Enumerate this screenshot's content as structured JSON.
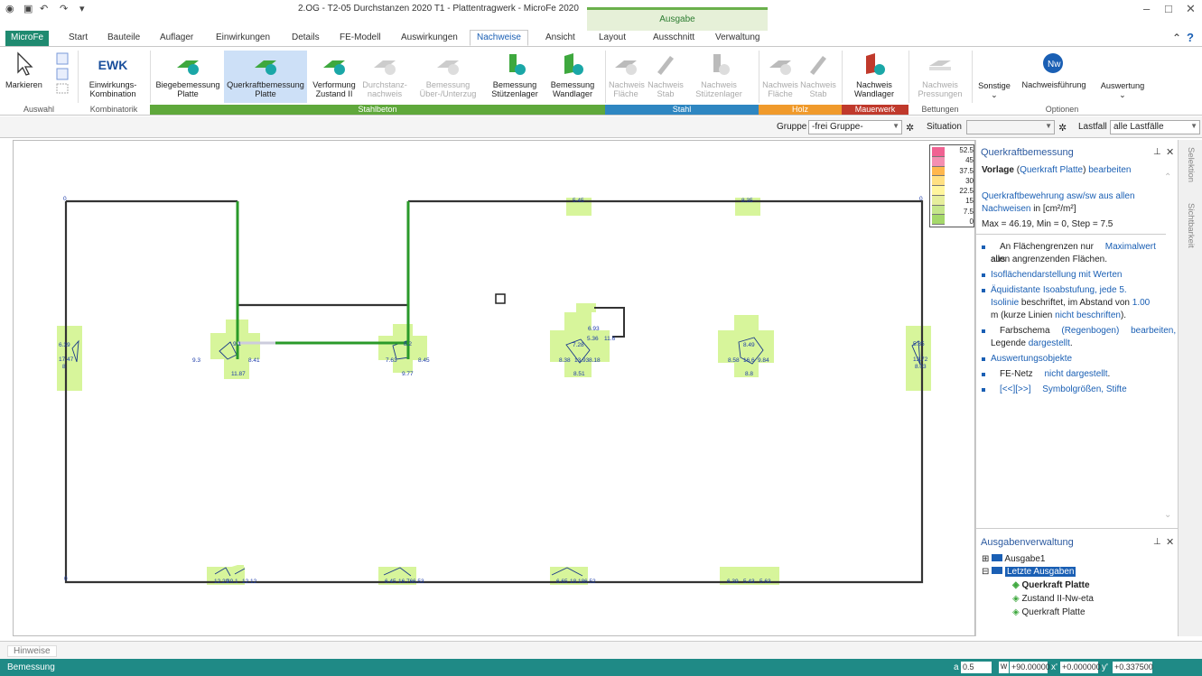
{
  "window": {
    "title": "2.OG - T2-05 Durchstanzen 2020 T1 - Plattentragwerk - MicroFe 2020",
    "context_group": "Ausgabe"
  },
  "tabs": [
    "Start",
    "Bauteile",
    "Auflager",
    "Einwirkungen",
    "Details",
    "FE-Modell",
    "Auswirkungen",
    "Nachweise",
    "Ansicht",
    "Layout",
    "Ausschnitt",
    "Verwaltung"
  ],
  "file_tab": "MicroFe",
  "ribbon": {
    "markieren": "Markieren",
    "ewk": "EWK",
    "ewk_label1": "Einwirkungs-",
    "ewk_label2": "Kombination",
    "biege1": "Biegebemessung",
    "biege2": "Platte",
    "quer1": "Querkraftbemessung",
    "quer2": "Platte",
    "verf1": "Verformung",
    "verf2": "Zustand II",
    "durch1": "Durchstanz-",
    "durch2": "nachweis",
    "bem1": "Bemessung",
    "bem2": "Über-/Unterzug",
    "bems1": "Bemessung",
    "bems2": "Stützenlager",
    "bemw1": "Bemessung",
    "bemw2": "Wandlager",
    "nf1": "Nachweis",
    "nf2": "Fläche",
    "ns1": "Nachweis",
    "ns2": "Stab",
    "nsl1": "Nachweis",
    "nsl2": "Stützenlager",
    "hf1": "Nachweis",
    "hf2": "Fläche",
    "hs1": "Nachweis",
    "hs2": "Stab",
    "nw1": "Nachweis",
    "nw2": "Wandlager",
    "np1": "Nachweis",
    "np2": "Pressungen",
    "sonstige": "Sonstige",
    "nwf": "Nachweisführung",
    "auswertung": "Auswertung",
    "groups": {
      "auswahl": "Auswahl",
      "kombinatorik": "Kombinatorik",
      "stahlbeton": "Stahlbeton",
      "stahl": "Stahl",
      "holz": "Holz",
      "mauerwerk": "Mauerwerk",
      "bettungen": "Bettungen",
      "optionen": "Optionen"
    }
  },
  "toolbar": {
    "gruppe_label": "Gruppe",
    "gruppe_value": "-frei Gruppe-",
    "situation_label": "Situation",
    "situation_value": "",
    "lastfall_label": "Lastfall",
    "lastfall_value": "alle Lastfälle"
  },
  "legend": {
    "values": [
      "52.5",
      "45",
      "37.5",
      "30",
      "22.5",
      "15",
      "7.5",
      "0"
    ],
    "colors": [
      "#f06292",
      "#f48fb1",
      "#ffb74d",
      "#ffe082",
      "#fff59d",
      "#e6ee9c",
      "#c5e68a",
      "#a5d86a"
    ]
  },
  "plot_labels": {
    "top": [
      "0",
      "5.45",
      "8.35",
      "0"
    ],
    "left": [
      "6.39",
      "17.47",
      "8"
    ],
    "right": [
      "5.85",
      "13.72",
      "8.03"
    ],
    "c1": [
      "9.3",
      "9.1",
      "8.41",
      "11.87"
    ],
    "c2": [
      "7.63",
      "8.2",
      "8.45",
      "9.77"
    ],
    "c3": [
      "6.93",
      "7.28",
      "5.36",
      "11.6",
      "8.38",
      "13.93",
      "8.18",
      "8.51"
    ],
    "c4": [
      "8.49",
      "8.58",
      "16.6",
      "9.84",
      "8.8"
    ],
    "bottom": [
      "12.29",
      "20.1",
      "12.12",
      "6.45",
      "16.76",
      "6.53",
      "6.65",
      "18.18",
      "6.52",
      "6.39",
      "5.43",
      "5.63"
    ],
    "corner_bl": "0"
  },
  "panel": {
    "title": "Querkraftbemessung",
    "vorlage": "Vorlage",
    "vorlage_paren_open": "(",
    "vorlage_link": "Querkraft Platte",
    "vorlage_paren_close": ")",
    "bearbeiten": "bearbeiten",
    "desc1": "Querkraftbewehrung asw/sw aus allen",
    "desc2": "Nachweisen",
    "desc3": "in [cm²/m²]",
    "maxmin": "Max = 46.19, Min = 0, Step = 7.5",
    "b1a": "An Flächengrenzen nur",
    "b1b": "Maximalwert",
    "b1c": "aus",
    "b1d": "allen angrenzenden Flächen.",
    "b2": "Isoflächendarstellung mit Werten",
    "b3a": "Äquidistante Isoabstufung, jede 5.",
    "b3b": "Isolinie",
    "b3c": "beschriftet, im Abstand von",
    "b3d": "1.00",
    "b3e": "m (kurze Linien",
    "b3f": "nicht beschriften",
    "b4a": "Farbschema",
    "b4b": "(Regenbogen)",
    "b4c": "bearbeiten,",
    "b4d": "Legende",
    "b4e": "dargestellt",
    "b5": "Auswertungsobjekte",
    "b6a": "FE-Netz",
    "b6b": "nicht dargestellt",
    "b7a": "[<<][>>]",
    "b7b": "Symbolgrößen, Stifte"
  },
  "ausgaben": {
    "title": "Ausgabenverwaltung",
    "items": [
      "Ausgabe1",
      "Letzte Ausgaben",
      "Querkraft Platte",
      "Zustand II-Nw-eta",
      "Querkraft Platte"
    ]
  },
  "vtabs": [
    "Selektion",
    "Sichtbarkeit"
  ],
  "hinweise": "Hinweise",
  "status": {
    "mode": "Bemessung",
    "a_label": "a",
    "a_val": "0.5",
    "w_label": "w",
    "w_val": "+90.00000",
    "x_label": "x'",
    "x_val": "+0.000000",
    "y_label": "y'",
    "y_val": "+0.337500"
  }
}
